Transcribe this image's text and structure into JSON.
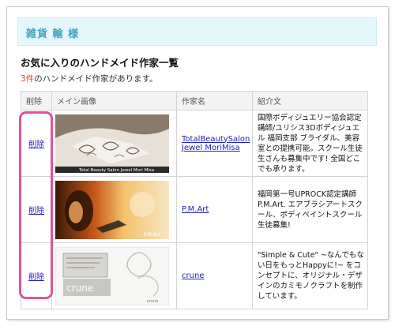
{
  "header": {
    "banner_label": "雑貨 輸 様"
  },
  "page": {
    "title": "お気に入りのハンドメイド作家一覧",
    "count_value": "3件",
    "count_suffix": "のハンドメイド作家があります。"
  },
  "table": {
    "columns": [
      "削除",
      "メイン画像",
      "作家名",
      "紹介文"
    ],
    "rows": [
      {
        "delete_label": "削除",
        "image_caption": "Total Beauty Salon Jewel Mori Misa",
        "name_line1": "TotalBeautySalon",
        "name_line2": "Jewel MoriMisa",
        "description": "国際ボディジュエリー協会認定講師/ユリシス3Dボディジュエル 福岡支部 ブライダル、美容室との提携可能。スクール生徒生さんも募集中です! 全国どこでも承ります。"
      },
      {
        "delete_label": "削除",
        "image_caption": "P.M.Art",
        "name_line1": "P.M.Art",
        "description": "福岡第一号UPROCK認定講師P.M.Art. エアブラシアートスクール、ボディペイントスクール生徒募集!"
      },
      {
        "delete_label": "削除",
        "image_caption": "crune",
        "image_sign": "crune",
        "name_line1": "crune",
        "description": "\"Simple & Cute\" ~なんでもない日をもっとHappyに!~ をコンセプトに、オリジナル・デザインのカミモノクラフトを制作しています。"
      }
    ]
  },
  "colors": {
    "banner_bg": "#e4f7fb",
    "banner_text": "#45a3bf",
    "count_accent": "#d24a1e",
    "link": "#2222bb",
    "highlight": "#e0539b"
  }
}
